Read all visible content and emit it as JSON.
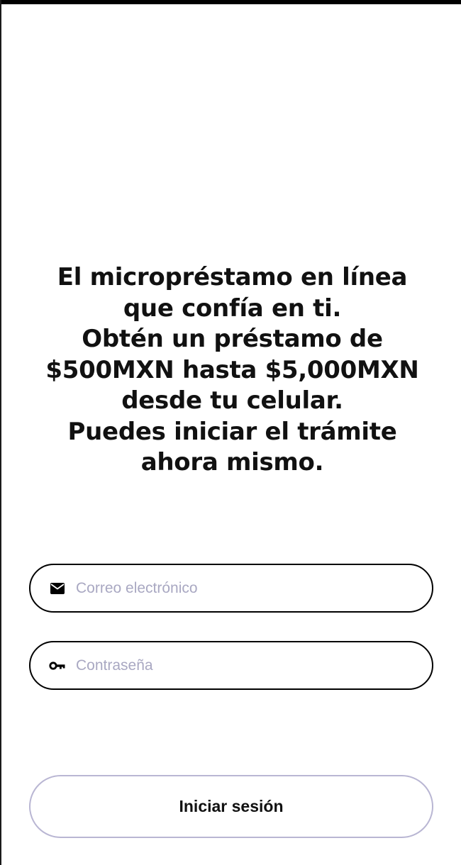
{
  "headline": {
    "lines": [
      "El micropréstamo en línea",
      "que confía en ti.",
      "Obtén un préstamo de",
      "$500MXN hasta $5,000MXN",
      "desde tu celular.",
      "Puedes iniciar el trámite",
      "ahora mismo."
    ]
  },
  "form": {
    "email": {
      "placeholder": "Correo electrónico",
      "value": "",
      "icon": "envelope-icon"
    },
    "password": {
      "placeholder": "Contraseña",
      "value": "",
      "icon": "key-icon"
    }
  },
  "login_button": {
    "label": "Iniciar sesión"
  },
  "colors": {
    "text": "#111111",
    "field_border": "#000000",
    "placeholder": "#a9a8c2",
    "button_border": "#b9b6d3",
    "background": "#ffffff"
  }
}
